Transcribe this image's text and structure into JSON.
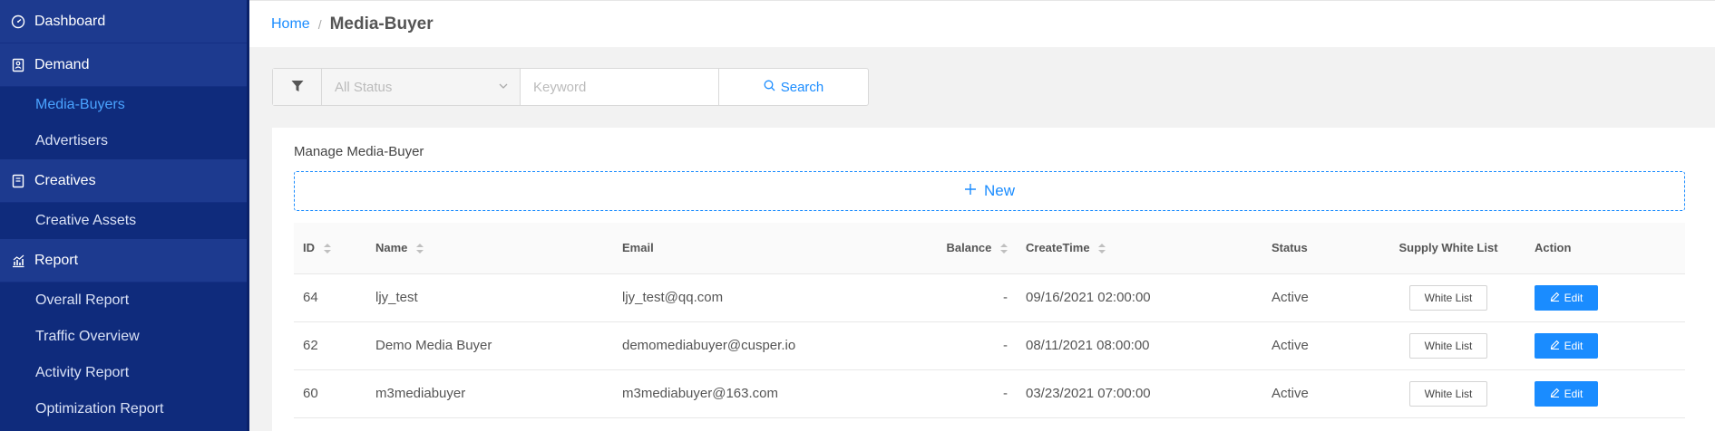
{
  "sidebar": {
    "items": [
      {
        "type": "group",
        "label": "Dashboard",
        "icon": "dashboard-icon"
      },
      {
        "type": "group",
        "label": "Demand",
        "icon": "demand-icon"
      },
      {
        "type": "item",
        "label": "Media-Buyers",
        "active": true
      },
      {
        "type": "item",
        "label": "Advertisers"
      },
      {
        "type": "group",
        "label": "Creatives",
        "icon": "creatives-icon"
      },
      {
        "type": "item",
        "label": "Creative Assets"
      },
      {
        "type": "group",
        "label": "Report",
        "icon": "report-icon"
      },
      {
        "type": "item",
        "label": "Overall Report"
      },
      {
        "type": "item",
        "label": "Traffic Overview"
      },
      {
        "type": "item",
        "label": "Activity Report"
      },
      {
        "type": "item",
        "label": "Optimization Report"
      }
    ]
  },
  "breadcrumb": {
    "home": "Home",
    "separator": "/",
    "current": "Media-Buyer"
  },
  "filter": {
    "status_placeholder": "All Status",
    "keyword_placeholder": "Keyword",
    "search_label": "Search"
  },
  "card": {
    "title": "Manage Media-Buyer",
    "new_label": "New"
  },
  "table": {
    "columns": {
      "id": "ID",
      "name": "Name",
      "email": "Email",
      "balance": "Balance",
      "create_time": "CreateTime",
      "status": "Status",
      "supply_white_list": "Supply White List",
      "action": "Action"
    },
    "rows": [
      {
        "id": "64",
        "name": "ljy_test",
        "email": "ljy_test@qq.com",
        "balance": "-",
        "create_time": "09/16/2021 02:00:00",
        "status": "Active",
        "white_list": "White List",
        "edit": "Edit"
      },
      {
        "id": "62",
        "name": "Demo Media Buyer",
        "email": "demomediabuyer@cusper.io",
        "balance": "-",
        "create_time": "08/11/2021 08:00:00",
        "status": "Active",
        "white_list": "White List",
        "edit": "Edit"
      },
      {
        "id": "60",
        "name": "m3mediabuyer",
        "email": "m3mediabuyer@163.com",
        "balance": "-",
        "create_time": "03/23/2021 07:00:00",
        "status": "Active",
        "white_list": "White List",
        "edit": "Edit"
      }
    ]
  },
  "colors": {
    "sidebar_bg": "#0f2b7c",
    "sidebar_group_bg": "#1d3a8f",
    "accent": "#1a8cff"
  }
}
